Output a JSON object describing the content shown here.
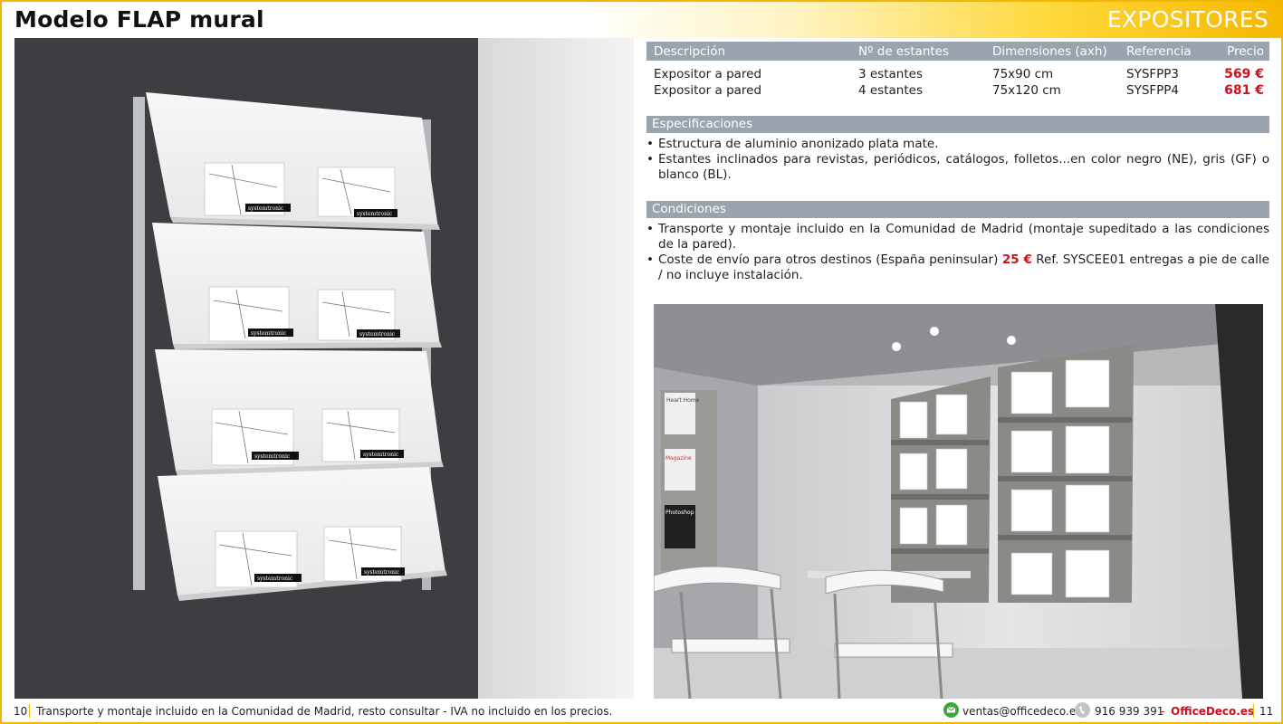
{
  "header": {
    "title": "Modelo FLAP mural",
    "section": "EXPOSITORES"
  },
  "table": {
    "headers": [
      "Descripción",
      "Nº de estantes",
      "Dimensiones (axh)",
      "Referencia",
      "Precio"
    ],
    "rows": [
      [
        "Expositor a pared",
        "3 estantes",
        "75x90 cm",
        "SYSFPP3",
        "569 €"
      ],
      [
        "Expositor a pared",
        "4 estantes",
        "75x120 cm",
        "SYSFPP4",
        "681 €"
      ]
    ]
  },
  "specs": {
    "title": "Especificaciones",
    "items": [
      "Estructura de aluminio anonizado plata mate.",
      "Estantes inclinados para revistas, periódicos, catálogos, folletos...en color negro (NE), gris (GF) o blanco (BL)."
    ]
  },
  "conditions": {
    "title": "Condiciones",
    "item1": "Transporte y montaje incluido en la Comunidad de Madrid (montaje supeditado a las condiciones de la pared).",
    "item2_pre": "Coste de envío para otros destinos (España peninsular) ",
    "item2_price": "25 €",
    "item2_post": " Ref. SYSCEE01 entregas a pie de calle / no incluye instalación."
  },
  "images": {
    "brand_label": "systemtronic",
    "magazines": [
      "Heart Home",
      "Magazine",
      "Photoshop"
    ]
  },
  "footer": {
    "page_left": "10",
    "note": "Transporte y montaje incluido en la Comunidad de Madrid, resto consultar - IVA no incluido en los precios.",
    "email": "ventas@officedeco.es",
    "phone": "916 939 391",
    "dash": "-",
    "brand": "OfficeDeco.es",
    "page_right": "11"
  },
  "colors": {
    "accent": "#f2b705",
    "price": "#d30f1a",
    "bar": "#9aa3ae"
  },
  "icons": [
    "mail-icon",
    "phone-icon"
  ]
}
